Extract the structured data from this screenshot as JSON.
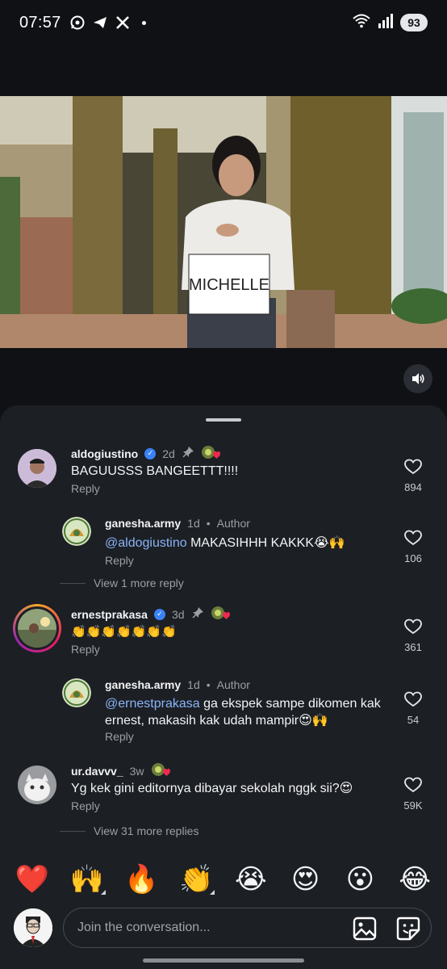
{
  "status": {
    "time": "07:57",
    "battery": "93",
    "app_icons": [
      "whatsapp-icon",
      "telegram-icon",
      "x-icon"
    ]
  },
  "comments": [
    {
      "user": "aldogiustino",
      "time": "2d",
      "text": "BAGUUSSS BANGEETTT!!!!",
      "reply": "Reply",
      "likes": "894",
      "verified": true,
      "pinned": true
    },
    {
      "user": "ganesha.army",
      "time": "1d",
      "author_tag": "Author",
      "mention": "@aldogiustino",
      "text": " MAKASIHHH KAKKK😭🙌",
      "reply": "Reply",
      "likes": "106"
    },
    {
      "user": "ernestprakasa",
      "time": "3d",
      "text": "👏👏👏👏👏👏👏",
      "reply": "Reply",
      "likes": "361",
      "verified": true,
      "pinned": true
    },
    {
      "user": "ganesha.army",
      "time": "1d",
      "author_tag": "Author",
      "mention": "@ernestprakasa",
      "text_line1": " ga ekspek sampe dikomen kak",
      "text_line2": "ernest, makasih kak udah mampir😍🙌",
      "reply": "Reply",
      "likes": "54"
    },
    {
      "user": "ur.davvv_",
      "time": "3w",
      "text": "Yg kek gini editornya dibayar sekolah nggk sii?😍",
      "reply": "Reply",
      "likes": "59K"
    }
  ],
  "view_more": [
    "View 1 more reply",
    "View 31 more replies"
  ],
  "author_dot": "•",
  "emoji_bar": [
    "❤️",
    "🙌",
    "🔥",
    "👏",
    "😭",
    "😍",
    "😮",
    "😂"
  ],
  "input": {
    "placeholder": "Join the conversation..."
  },
  "video": {
    "sign_text": "MICHELLE"
  }
}
